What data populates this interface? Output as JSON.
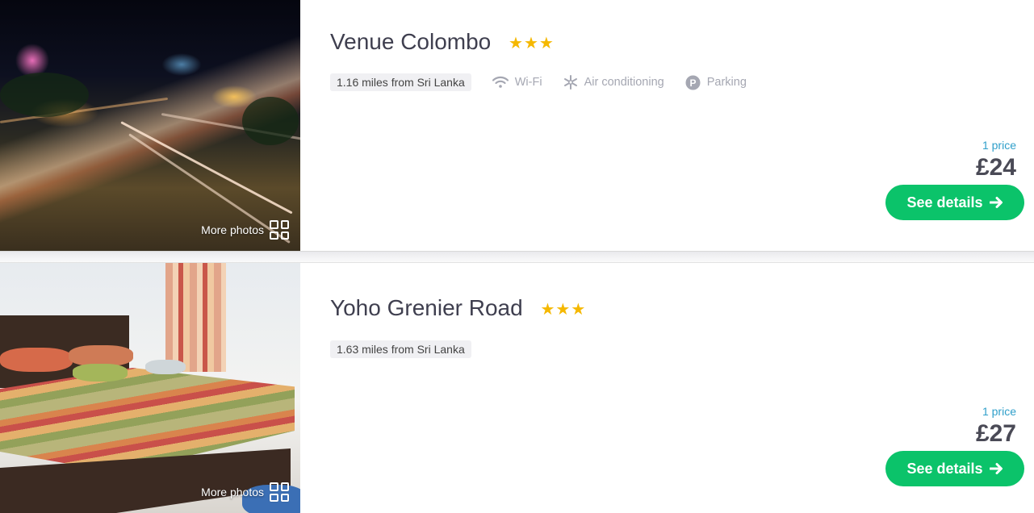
{
  "listings": [
    {
      "name": "Venue Colombo",
      "stars": "★★★",
      "distance": "1.16 miles from Sri Lanka",
      "amenities": [
        "Wi-Fi",
        "Air conditioning",
        "Parking"
      ],
      "price_count": "1 price",
      "price": "£24",
      "cta": "See details",
      "more_photos": "More photos"
    },
    {
      "name": "Yoho Grenier Road",
      "stars": "★★★",
      "distance": "1.63 miles from Sri Lanka",
      "amenities": [],
      "price_count": "1 price",
      "price": "£27",
      "cta": "See details",
      "more_photos": "More photos"
    }
  ],
  "colors": {
    "star": "#f5b800",
    "button": "#0bc36a",
    "price_count": "#2f9fca",
    "amenity": "#a5a7b2"
  },
  "icons": {
    "amenities": [
      "wifi-icon",
      "snowflake-icon",
      "parking-icon"
    ],
    "cta": "arrow-right-icon",
    "photos": "grid-icon"
  }
}
